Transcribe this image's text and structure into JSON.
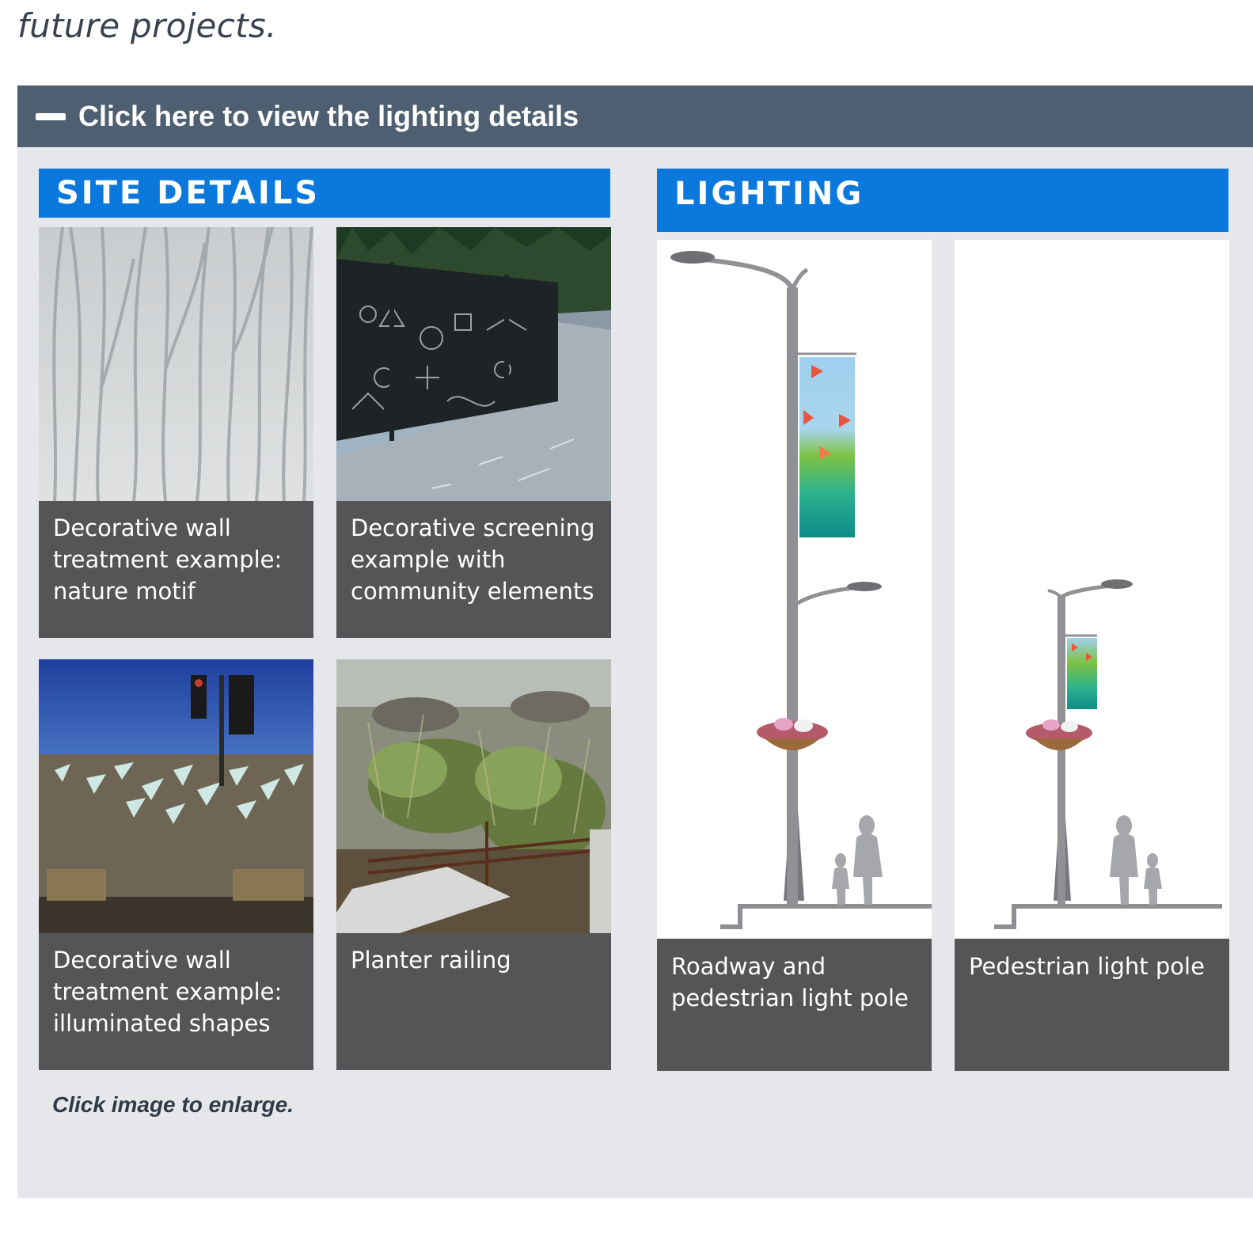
{
  "intro_text": "future projects.",
  "accordion": {
    "title": "Click here to view the lighting details",
    "toggle_icon": "minus-icon"
  },
  "site_details": {
    "heading": "SITE DETAILS",
    "cards": [
      {
        "caption": "Decorative wall treatment example: nature motif"
      },
      {
        "caption": "Decorative screening example with community elements"
      },
      {
        "caption": "Decorative wall treatment example: illuminated shapes"
      },
      {
        "caption": "Planter railing"
      }
    ]
  },
  "lighting": {
    "heading": "LIGHTING",
    "cards": [
      {
        "caption": "Roadway and pedestrian light pole"
      },
      {
        "caption": "Pedestrian light pole"
      }
    ]
  },
  "footnote": "Click image to enlarge.",
  "colors": {
    "header_bg": "#4d5f70",
    "banner_blue": "#0a78dc",
    "caption_bg": "#555557",
    "panel_bg": "#e5e7eb"
  }
}
